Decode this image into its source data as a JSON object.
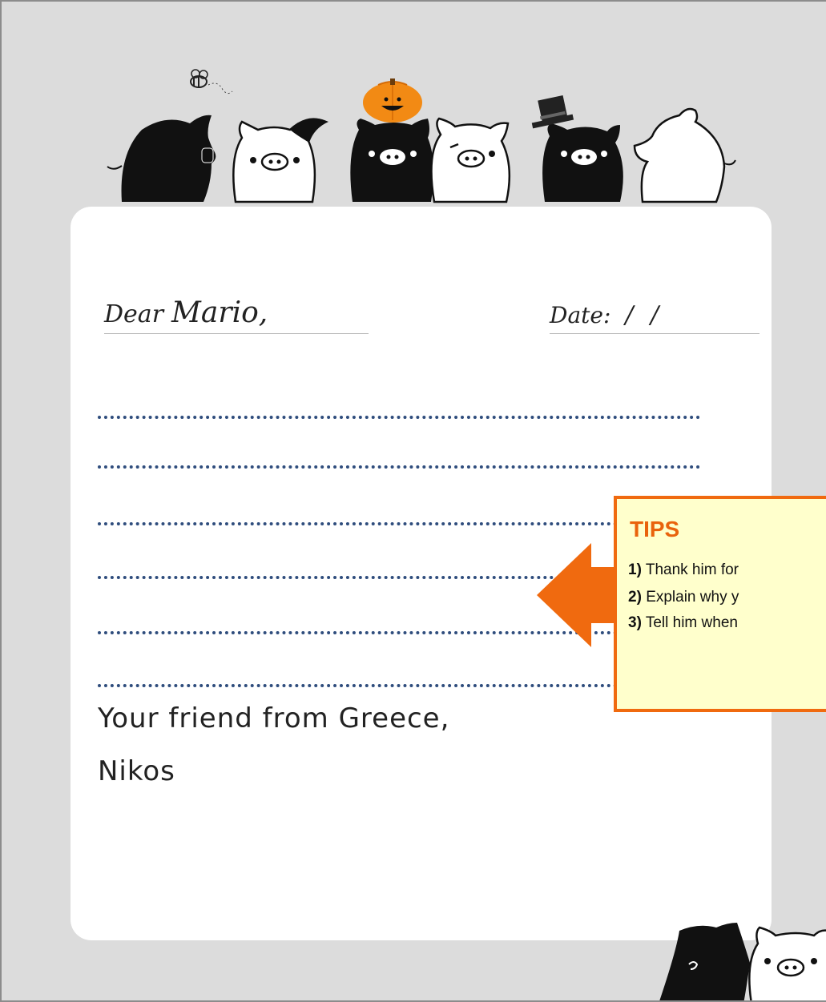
{
  "letter": {
    "greeting_label": "Dear",
    "greeting_name": "Mario,",
    "date_label": "Date:",
    "date_value": "/ /",
    "closing_line_1": "Your friend from Greece,",
    "closing_line_2": "Nikos"
  },
  "tips": {
    "title": "TIPS",
    "items": [
      {
        "number": "1)",
        "text": "Thank him for"
      },
      {
        "number": "2)",
        "text": "Explain why y"
      },
      {
        "number": "3)",
        "text": "Tell him when"
      }
    ]
  },
  "colors": {
    "background": "#dcdcdc",
    "accent": "#f06a0f",
    "tips_fill": "#ffffcc",
    "dotted_lines": "#2f4d7d"
  },
  "icons": [
    "bee-icon",
    "pumpkin-icon",
    "top-hat-icon",
    "pig-icon"
  ]
}
